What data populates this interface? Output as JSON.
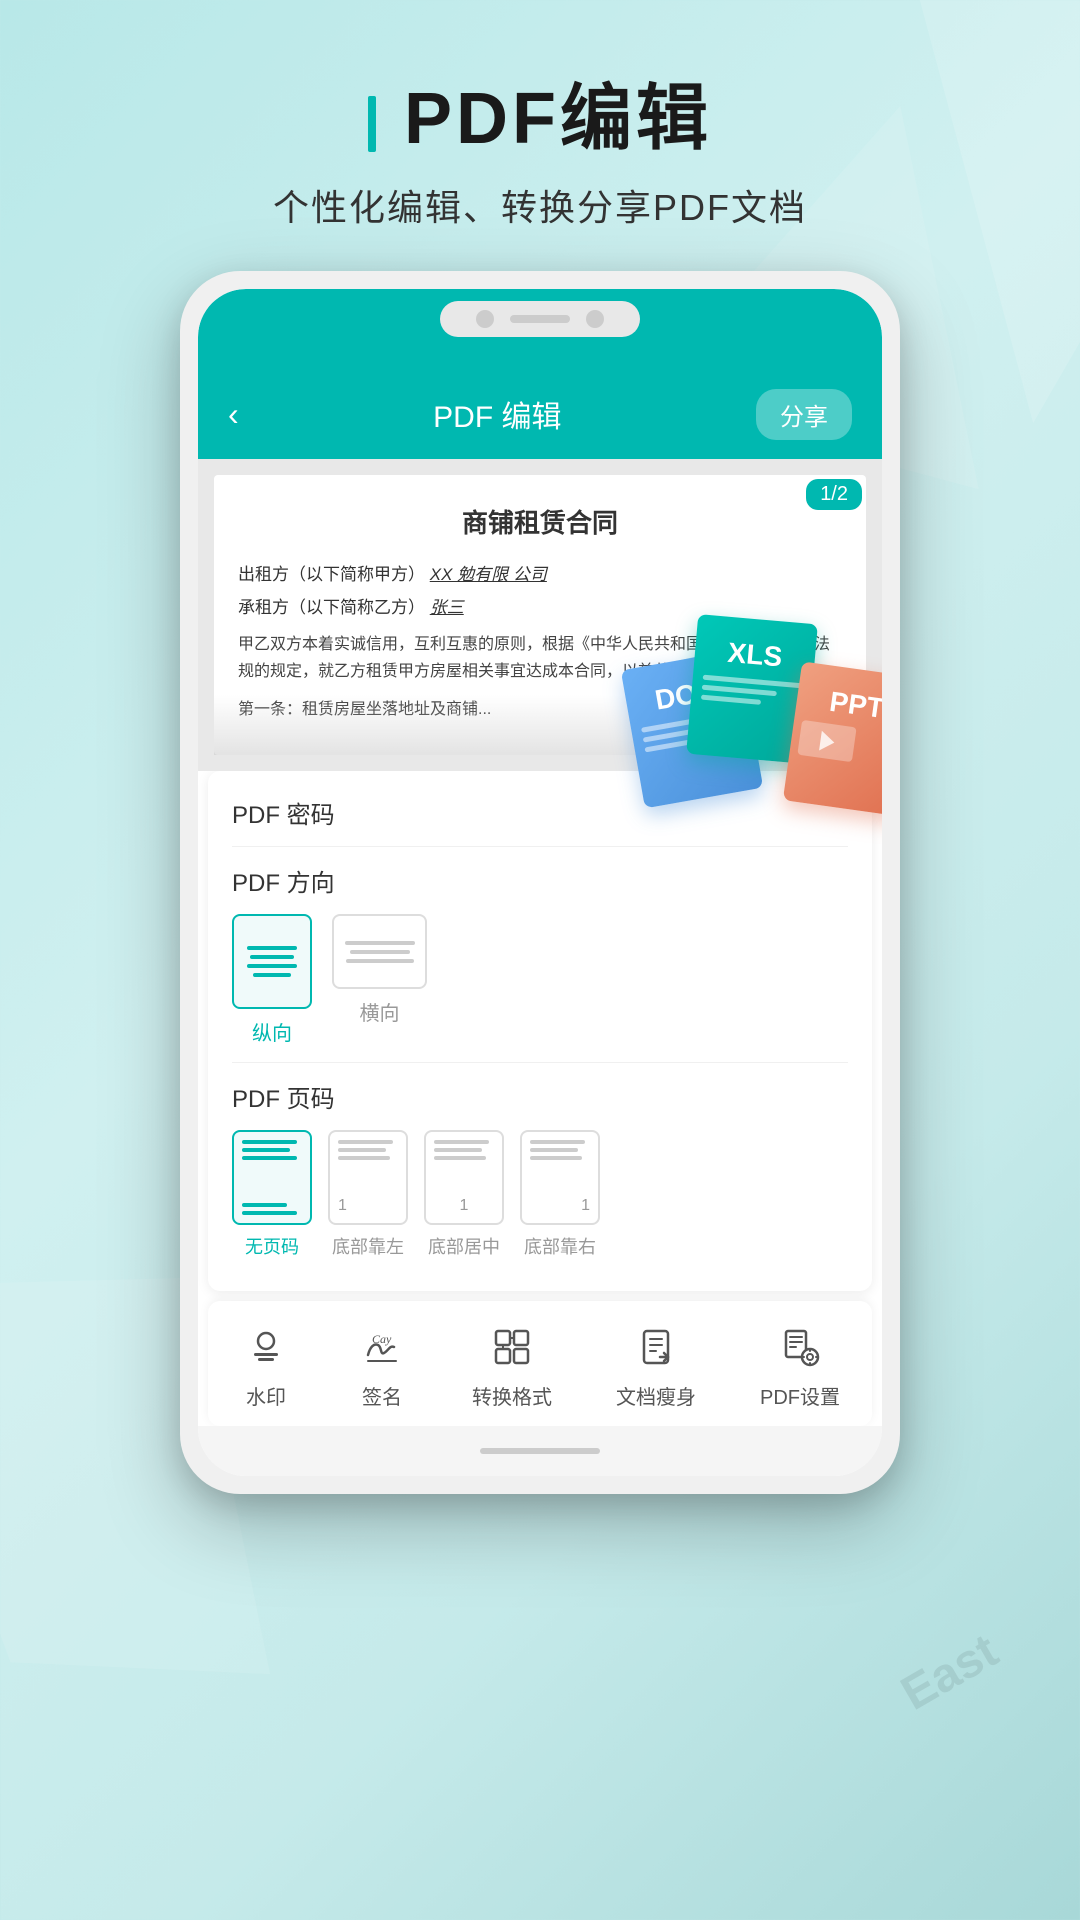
{
  "header": {
    "title": "PDF编辑",
    "subtitle": "个性化编辑、转换分享PDF文档"
  },
  "appbar": {
    "back_icon": "‹",
    "title": "PDF 编辑",
    "share_label": "分享"
  },
  "document": {
    "page_badge": "1/2",
    "doc_title": "商铺租赁合同",
    "line1_prefix": "出租方（以下简称甲方）",
    "line1_value": "XX 勉有限 公司",
    "line2_prefix": "承租方（以下简称乙方）",
    "line2_value": "张三",
    "body_text": "甲乙双方本着实诚信用，互利互惠的原则，根据《中华人民共和国合同法》法律、法规的规定，就乙方租赁甲方房屋相关事宜达成本合同，以兹共同遵守：",
    "article1": "第一条：租赁房屋坐落地址及商铺..."
  },
  "file_types": {
    "doc_label": "DOC",
    "xls_label": "XLS",
    "ppt_label": "PPT"
  },
  "settings": {
    "password_label": "PDF 密码",
    "direction_label": "PDF 方向",
    "pageno_label": "PDF 页码",
    "directions": [
      {
        "id": "vertical",
        "label": "纵向",
        "active": true
      },
      {
        "id": "horizontal",
        "label": "横向",
        "active": false
      }
    ],
    "pagenumbers": [
      {
        "id": "none",
        "label": "无页码",
        "active": true,
        "number": ""
      },
      {
        "id": "bottom-left",
        "label": "底部靠左",
        "active": false,
        "number": "1"
      },
      {
        "id": "bottom-center",
        "label": "底部居中",
        "active": false,
        "number": "1"
      },
      {
        "id": "bottom-right",
        "label": "底部靠右",
        "active": false,
        "number": "1"
      }
    ]
  },
  "toolbar": {
    "items": [
      {
        "id": "watermark",
        "label": "水印",
        "icon": "watermark"
      },
      {
        "id": "signature",
        "label": "签名",
        "icon": "signature"
      },
      {
        "id": "convert",
        "label": "转换格式",
        "icon": "convert"
      },
      {
        "id": "slim",
        "label": "文档瘦身",
        "icon": "slim"
      },
      {
        "id": "pdf-settings",
        "label": "PDF设置",
        "icon": "settings"
      }
    ]
  },
  "brand_color": "#00b8b0",
  "east_watermark": "East"
}
